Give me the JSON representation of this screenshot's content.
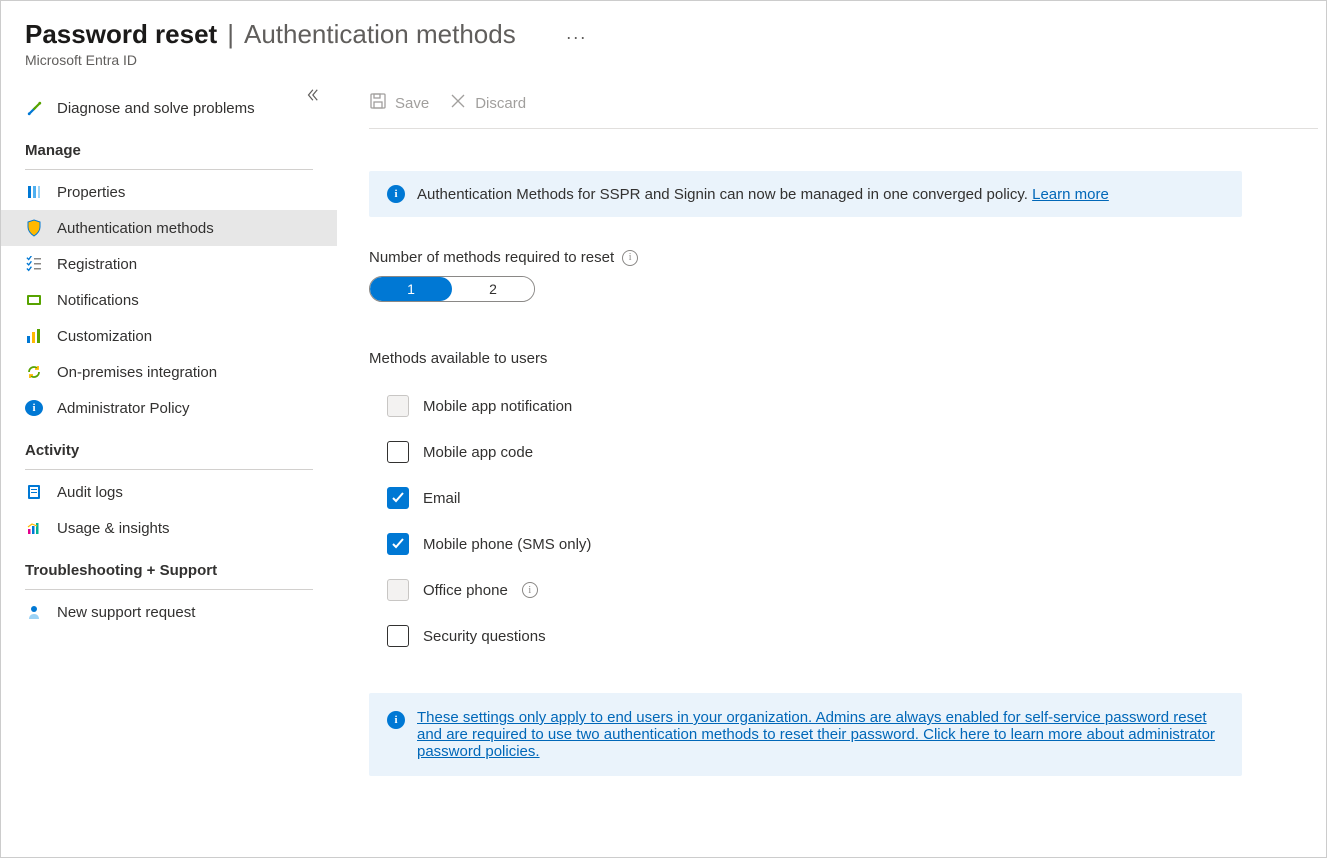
{
  "header": {
    "title_main": "Password reset",
    "title_separator": "|",
    "title_section": "Authentication methods",
    "subtitle": "Microsoft Entra ID",
    "more_glyph": "···"
  },
  "toolbar": {
    "save": "Save",
    "discard": "Discard"
  },
  "sidebar": {
    "top": [
      {
        "key": "diagnose",
        "label": "Diagnose and solve problems"
      }
    ],
    "groups": [
      {
        "header": "Manage",
        "items": [
          {
            "key": "properties",
            "label": "Properties"
          },
          {
            "key": "authmethods",
            "label": "Authentication methods",
            "selected": true
          },
          {
            "key": "registration",
            "label": "Registration"
          },
          {
            "key": "notifications",
            "label": "Notifications"
          },
          {
            "key": "customization",
            "label": "Customization"
          },
          {
            "key": "onprem",
            "label": "On-premises integration"
          },
          {
            "key": "adminpolicy",
            "label": "Administrator Policy"
          }
        ]
      },
      {
        "header": "Activity",
        "items": [
          {
            "key": "auditlogs",
            "label": "Audit logs"
          },
          {
            "key": "usage",
            "label": "Usage & insights"
          }
        ]
      },
      {
        "header": "Troubleshooting + Support",
        "items": [
          {
            "key": "support",
            "label": "New support request"
          }
        ]
      }
    ]
  },
  "banner_top": {
    "text": "Authentication Methods for SSPR and Signin can now be managed in one converged policy. ",
    "link": "Learn more"
  },
  "num_required": {
    "label": "Number of methods required to reset",
    "options": [
      "1",
      "2"
    ],
    "selected": "1"
  },
  "methods": {
    "label": "Methods available to users",
    "items": [
      {
        "key": "app_notif",
        "label": "Mobile app notification",
        "checked": false,
        "disabled": true
      },
      {
        "key": "app_code",
        "label": "Mobile app code",
        "checked": false,
        "disabled": false
      },
      {
        "key": "email",
        "label": "Email",
        "checked": true,
        "disabled": false
      },
      {
        "key": "sms",
        "label": "Mobile phone (SMS only)",
        "checked": true,
        "disabled": false
      },
      {
        "key": "office",
        "label": "Office phone",
        "checked": false,
        "disabled": true,
        "has_info": true
      },
      {
        "key": "secq",
        "label": "Security questions",
        "checked": false,
        "disabled": false
      }
    ]
  },
  "banner_bottom": {
    "link": "These settings only apply to end users in your organization. Admins are always enabled for self-service password reset and are required to use two authentication methods to reset their password. Click here to learn more about administrator password policies."
  }
}
